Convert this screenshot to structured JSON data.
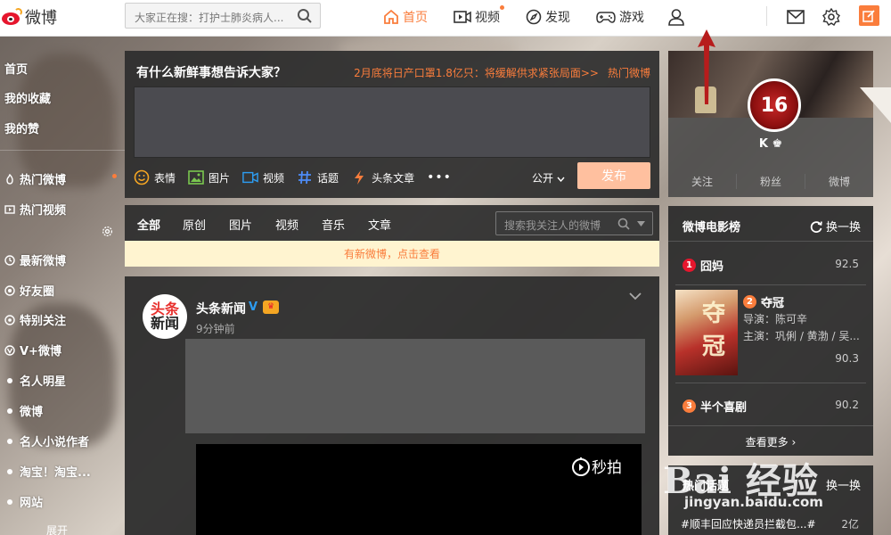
{
  "topbar": {
    "logo_text": "微博",
    "search_text": "大家正在搜：打护士肺炎病人...",
    "nav": {
      "home": "首页",
      "video": "视频",
      "discover": "发现",
      "game": "游戏"
    },
    "accent_color": "#fa7d3c"
  },
  "sidebar": {
    "top_items": [
      "首页",
      "我的收藏",
      "我的赞"
    ],
    "items": [
      "热门微博",
      "热门视频",
      "最新微博",
      "好友圈",
      "特别关注",
      "V+微博"
    ],
    "groups": [
      "名人明星",
      "微博",
      "名人小说作者",
      "淘宝！淘宝...",
      "网站"
    ],
    "expand": "展开"
  },
  "publisher": {
    "title": "有什么新鲜事想告诉大家？",
    "hot_text": "2月底将日产口罩1.8亿只：将缓解供求紧张局面>>",
    "hot_link": "热门微博",
    "tools": [
      "表情",
      "图片",
      "视频",
      "话题",
      "头条文章"
    ],
    "more": "•••",
    "public": "公开",
    "submit": "发布"
  },
  "feed_tabs": {
    "tabs": [
      "全部",
      "原创",
      "图片",
      "视频",
      "音乐",
      "文章"
    ],
    "search_placeholder": "搜索我关注人的微博",
    "new_notice": "有新微博，点击查看"
  },
  "post": {
    "avatar_top": "头条",
    "avatar_bottom": "新闻",
    "author": "头条新闻",
    "verified": "V",
    "time": "9分钟前",
    "video_brand": "秒拍"
  },
  "profile": {
    "avatar_text": "16",
    "name": "K",
    "stats": [
      "关注",
      "粉丝",
      "微博"
    ]
  },
  "movies": {
    "title": "微博电影榜",
    "refresh": "换一换",
    "items": [
      {
        "rank": "1",
        "name": "囧妈",
        "score": "92.5",
        "color": "#e6162d"
      },
      {
        "rank": "2",
        "name": "夺冠",
        "score": "90.3",
        "color": "#fa7d3c",
        "director": "导演：陈可辛",
        "cast": "主演：巩俐 / 黄渤 / 吴...",
        "poster_text": "夺冠"
      },
      {
        "rank": "3",
        "name": "半个喜剧",
        "score": "90.2",
        "color": "#fa7d3c"
      }
    ],
    "view_more": "查看更多"
  },
  "topics": {
    "title": "热门话题",
    "refresh": "换一换",
    "item": "#顺丰回应快递员拦截包...#",
    "count": "2亿"
  },
  "watermark": {
    "logo": "Bai 经验",
    "url": "jingyan.baidu.com"
  }
}
